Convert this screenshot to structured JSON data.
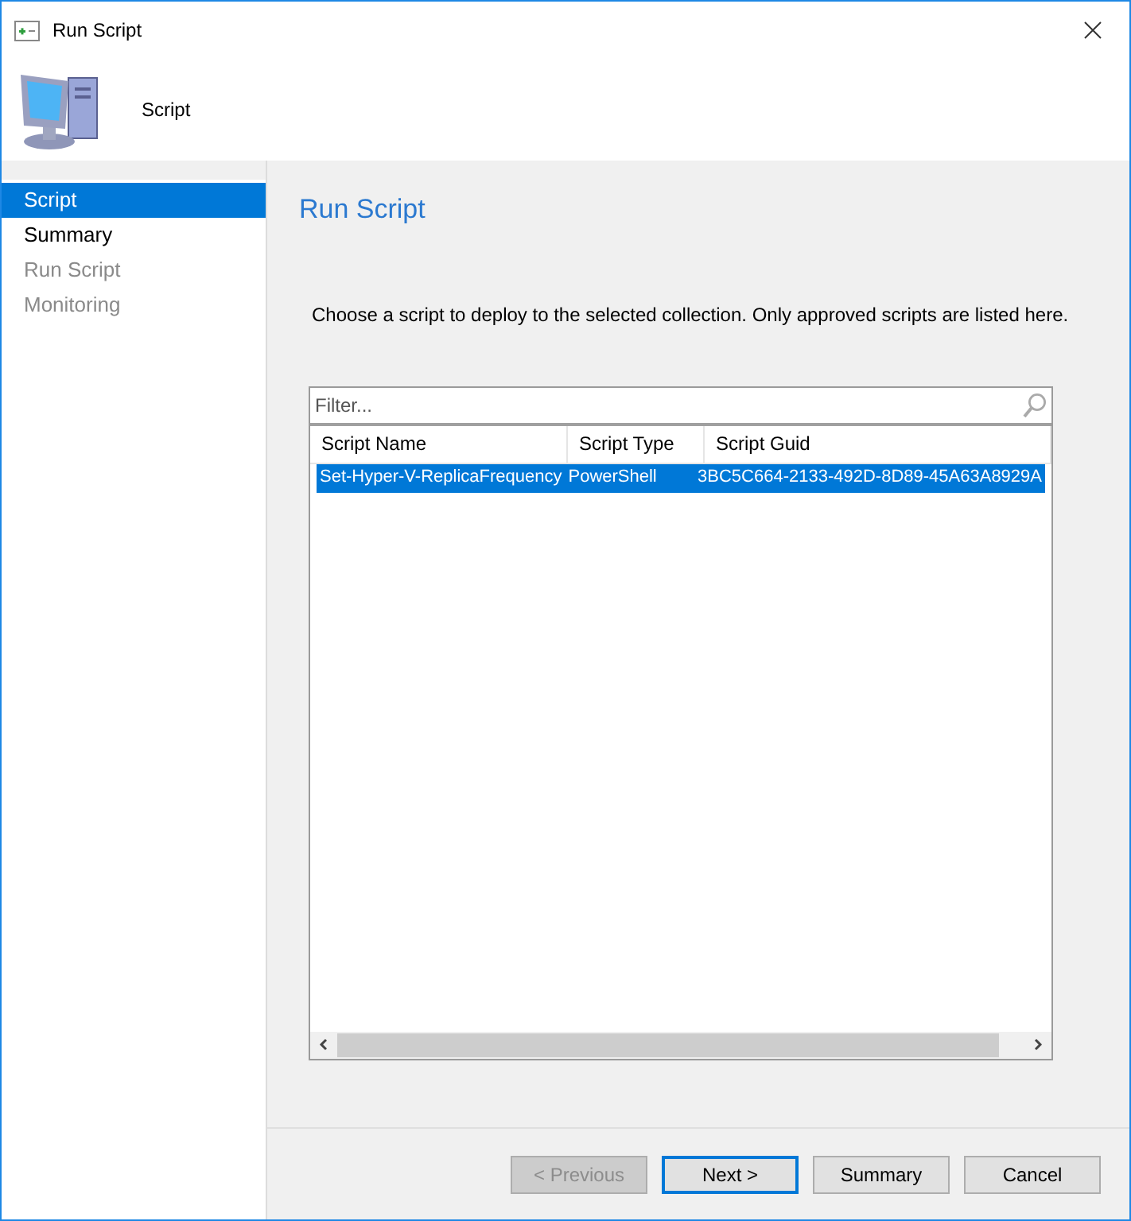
{
  "window": {
    "title": "Run Script"
  },
  "header": {
    "title": "Script"
  },
  "sidebar": {
    "items": [
      {
        "label": "Script",
        "selected": true,
        "disabled": false
      },
      {
        "label": "Summary",
        "selected": false,
        "disabled": false
      },
      {
        "label": "Run Script",
        "selected": false,
        "disabled": true
      },
      {
        "label": "Monitoring",
        "selected": false,
        "disabled": true
      }
    ]
  },
  "page": {
    "title": "Run Script",
    "description": "Choose a script to deploy to the selected collection. Only approved scripts are listed here."
  },
  "filter": {
    "placeholder": "Filter..."
  },
  "table": {
    "columns": [
      "Script Name",
      "Script Type",
      "Script Guid"
    ],
    "rows": [
      {
        "cells": [
          "Set-Hyper-V-ReplicaFrequency",
          "PowerShell",
          "3BC5C664-2133-492D-8D89-45A63A8929A"
        ],
        "selected": true
      }
    ]
  },
  "buttons": [
    {
      "label": "< Previous",
      "disabled": true,
      "default": false
    },
    {
      "label": "Next >",
      "disabled": false,
      "default": true
    },
    {
      "label": "Summary",
      "disabled": false,
      "default": false
    },
    {
      "label": "Cancel",
      "disabled": false,
      "default": false
    }
  ]
}
